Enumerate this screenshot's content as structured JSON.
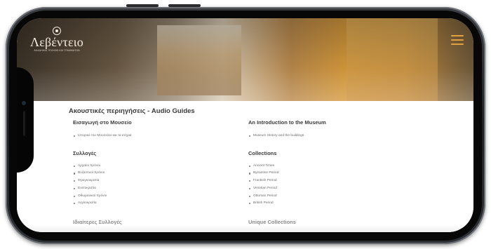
{
  "logo": {
    "text": "Λεβέντειο",
    "subtitle": "ΑΚΑΔΗΜΙΑ ΤΕΧΝΩΝ ΚΑΙ ΓΡΑΜΜΑΤΩΝ",
    "icon": "heart-seal-icon"
  },
  "header": {
    "menu_icon": "hamburger-menu-icon",
    "accent": "#e0a13e"
  },
  "page": {
    "title": "Ακουστικές περιηγήσεις - Audio Guides"
  },
  "greek": {
    "intro": {
      "title": "Εισαγωγή στο Μουσείο",
      "items": [
        "Ιστορικό του Μουσείου και τα κτήρια"
      ]
    },
    "collections": {
      "title": "Συλλογές",
      "items": [
        "Αρχαίοι Χρόνοι",
        "Βυζαντινοί Χρόνοι",
        "Φραγκοκρατία",
        "Ενετοκρατία",
        "Οθωμανικοί Χρόνοι",
        "Αγγλοκρατία"
      ]
    },
    "next": {
      "title": "Ιδιαίτερες Συλλογές"
    }
  },
  "english": {
    "intro": {
      "title": "An Introduction to the Museum",
      "items": [
        "Museum History and the buildings"
      ]
    },
    "collections": {
      "title": "Collections",
      "items": [
        "Ancient Times",
        "Byzantine Period",
        "Frankish Period",
        "Venetian Period",
        "Ottoman Period",
        "British Period"
      ]
    },
    "next": {
      "title": "Unique Collections"
    }
  }
}
